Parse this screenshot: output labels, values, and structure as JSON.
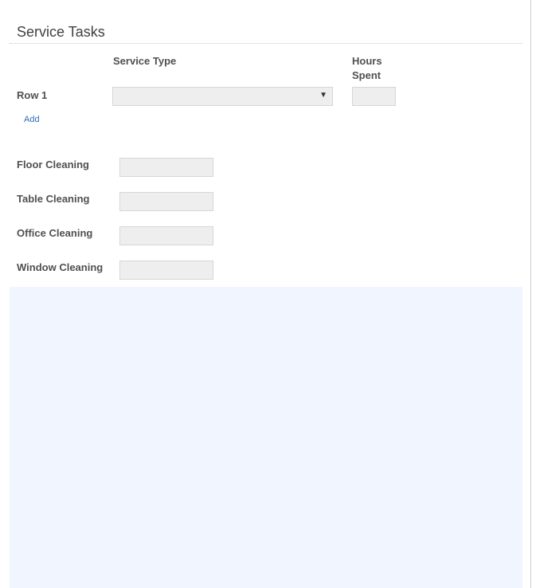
{
  "section": {
    "title": "Service Tasks"
  },
  "grid": {
    "headers": {
      "service_type": "Service Type",
      "hours_spent_line1": "Hours",
      "hours_spent_line2": "Spent"
    },
    "rows": [
      {
        "label": "Row 1",
        "service_type_value": "",
        "hours_value": ""
      }
    ],
    "add_label": "Add"
  },
  "fields": [
    {
      "label": "Floor Cleaning",
      "value": ""
    },
    {
      "label": "Table Cleaning",
      "value": ""
    },
    {
      "label": "Office Cleaning",
      "value": ""
    },
    {
      "label": "Window Cleaning",
      "value": ""
    }
  ],
  "icons": {
    "select_arrow": "▼"
  },
  "colors": {
    "link": "#2a6fb8",
    "input_bg": "#eeeeee",
    "panel_bg": "#f0f5ff"
  }
}
